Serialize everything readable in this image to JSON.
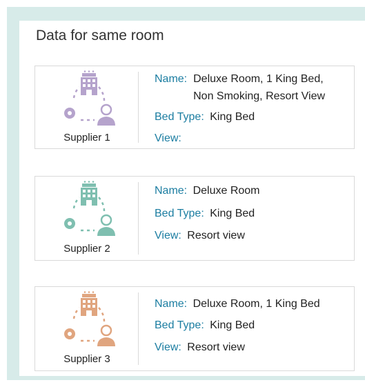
{
  "title": "Data for same room",
  "labels": {
    "name": "Name:",
    "bed_type": "Bed Type:",
    "view": "View:"
  },
  "suppliers": [
    {
      "label": "Supplier 1",
      "name_line1": "Deluxe Room, 1 King Bed,",
      "name_line2": "Non Smoking, Resort View",
      "bed_type": "King Bed",
      "view": "",
      "color": "#b5a3cc",
      "icon": "hotel-supplier-icon"
    },
    {
      "label": "Supplier 2",
      "name_line1": "Deluxe Room",
      "bed_type": "King Bed",
      "view": "Resort view",
      "color": "#7fbfb0",
      "icon": "hotel-supplier-icon"
    },
    {
      "label": "Supplier 3",
      "name_line1": "Deluxe Room, 1 King Bed",
      "bed_type": "King Bed",
      "view": "Resort view",
      "color": "#e0a57f",
      "icon": "hotel-supplier-icon"
    }
  ]
}
